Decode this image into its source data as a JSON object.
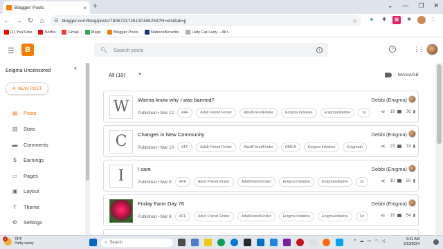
{
  "browser": {
    "tab_title": "Blogger: Posts",
    "new_tab": "+",
    "url": "blogger.com/blog/posts/7806723726130168254?hl=en&tab=jj",
    "bookmarks": [
      {
        "label": "(1) YouTube",
        "color": "#ff0000"
      },
      {
        "label": "Netflix",
        "color": "#e50914"
      },
      {
        "label": "Gmail",
        "color": "#ea4335"
      },
      {
        "label": "Maps",
        "color": "#34a853"
      },
      {
        "label": "Blogger Posts",
        "color": "#f57d00"
      },
      {
        "label": "NationsBenefits",
        "color": "#1a3b6e"
      },
      {
        "label": "Lady Cat Lady – All t...",
        "color": "#b0b0b0"
      }
    ]
  },
  "app": {
    "search_placeholder": "Search posts",
    "brand_color": "#f57d00",
    "accent_color": "#e8710a"
  },
  "sidebar": {
    "blog_name": "Enigma Uncensored",
    "new_post_label": "NEW POST",
    "items": [
      {
        "label": "Posts",
        "icon": "posts-icon",
        "active": true
      },
      {
        "label": "Stats",
        "icon": "stats-icon"
      },
      {
        "label": "Comments",
        "icon": "comments-icon"
      },
      {
        "label": "Earnings",
        "icon": "earnings-icon"
      },
      {
        "label": "Pages",
        "icon": "pages-icon"
      },
      {
        "label": "Layout",
        "icon": "layout-icon"
      },
      {
        "label": "Theme",
        "icon": "theme-icon"
      },
      {
        "label": "Settings",
        "icon": "settings-icon"
      }
    ]
  },
  "main": {
    "filter_label": "All (10)",
    "manage_label": "MANAGE",
    "posts": [
      {
        "thumb": "W",
        "title": "Wanna know why I was banned?",
        "meta": "Published • Mar 12",
        "labels": [
          "AFF",
          "Adult Friend Finder",
          "AdultFriendFinder",
          "Enigma Initiative",
          "Enigmainitiative",
          "Jo"
        ],
        "author": "Debbi (Enigma)",
        "comments": "18",
        "views": "36"
      },
      {
        "thumb": "C",
        "title": "Changes in New Community",
        "meta": "Published • Mar 10",
        "labels": [
          "AFF",
          "Adult Friend Finder",
          "AdultFriendFinder",
          "DMCA",
          "Enigma Initiative",
          "EnigmaIn"
        ],
        "author": "Debbi (Enigma)",
        "comments": "23",
        "views": "74"
      },
      {
        "thumb": "I",
        "title": "I care",
        "meta": "Published • Mar 9",
        "labels": [
          "AFF",
          "Adult Friend Finder",
          "AdultFriendFinder",
          "Enigma Initiative",
          "Enigmainitiative",
          "Jo"
        ],
        "author": "Debbi (Enigma)",
        "comments": "10",
        "views": "50"
      },
      {
        "thumb": "",
        "title": "Friday Farm Day 76",
        "meta": "Published • Mar 8",
        "labels": [
          "AFF",
          "Adult Friend Finder",
          "AdultFriendFinder",
          "Enigma Initiative",
          "Enigmainitiative",
          "Fri"
        ],
        "author": "Debbi (Enigma)",
        "comments": "16",
        "views": "54"
      }
    ]
  },
  "taskbar": {
    "temp": "78°F",
    "weather": "Partly sunny",
    "weather_badge": "1",
    "search": "Search",
    "time": "9:31 AM",
    "date": "3/13/2024"
  }
}
